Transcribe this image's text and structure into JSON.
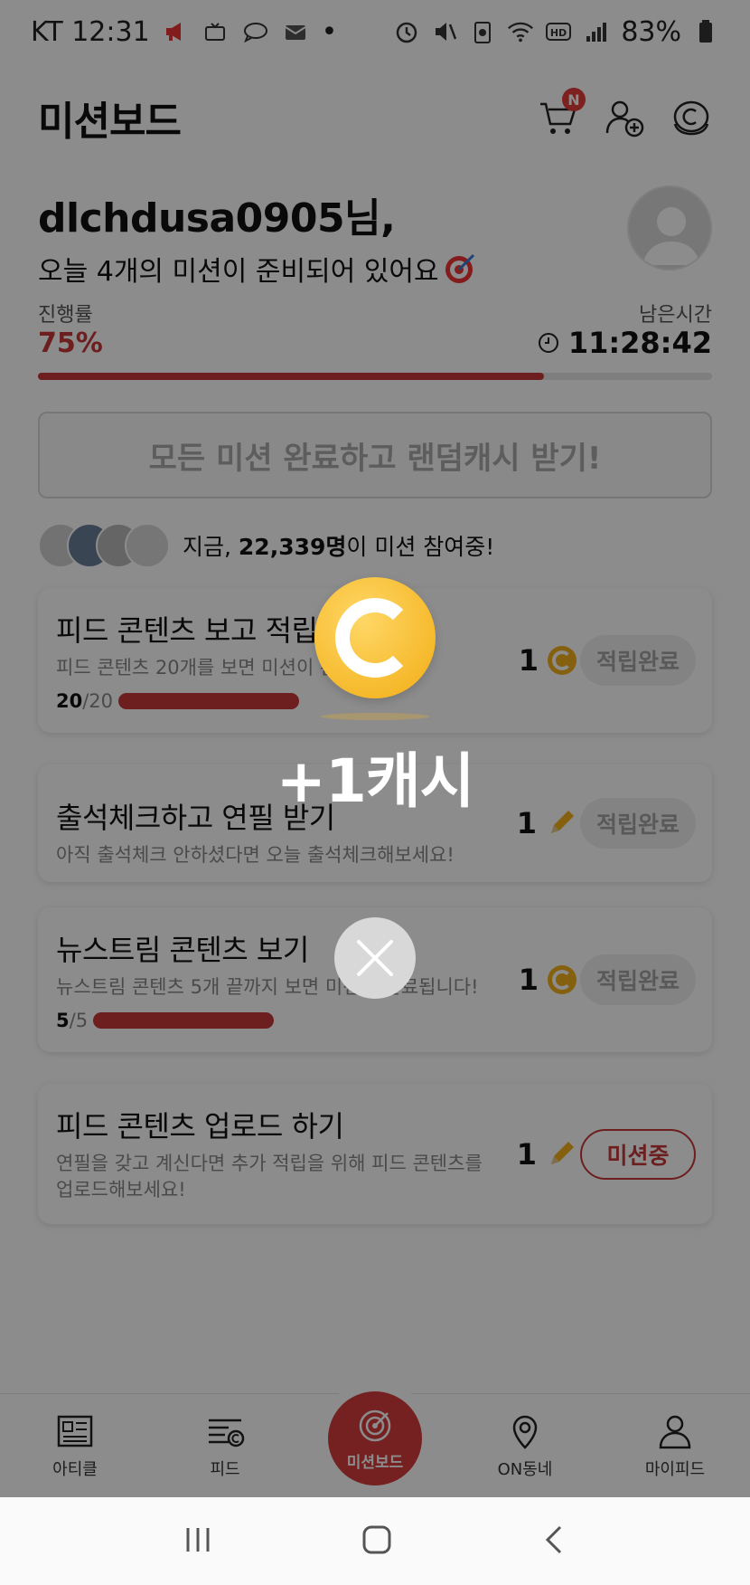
{
  "statusbar": {
    "carrier_time": "KT 12:31",
    "battery": "83%"
  },
  "header": {
    "title": "미션보드",
    "cart_badge": "N"
  },
  "greeting": {
    "username": "dlchdusa0905님,",
    "subtitle": "오늘 4개의 미션이 준비되어 있어요"
  },
  "progress": {
    "label": "진행률",
    "value": "75%",
    "fraction": 0.75,
    "remaining_label": "남은시간",
    "remaining_time": "11:28:42"
  },
  "all_complete_button": "모든 미션 완료하고 랜덤캐시 받기!",
  "participants": {
    "prefix": "지금, ",
    "count": "22,339명",
    "suffix": "이 미션 참여중!"
  },
  "missions": [
    {
      "title": "피드 콘텐츠 보고 적립",
      "desc": "피드 콘텐츠 20개를 보면 미션이 완",
      "progress_current": "20",
      "progress_total": "/20",
      "reward": "1",
      "reward_type": "coin",
      "state": "적립완료"
    },
    {
      "title": "출석체크하고 연필 받기",
      "desc": "아직 출석체크 안하셨다면 오늘 출석체크해보세요!",
      "reward": "1",
      "reward_type": "pencil",
      "state": "적립완료"
    },
    {
      "title": "뉴스트림 콘텐츠 보기",
      "desc": "뉴스트림 콘텐츠 5개 끝까지 보면 미션이 완료됩니다!",
      "progress_current": "5",
      "progress_total": "/5",
      "reward": "1",
      "reward_type": "coin",
      "state": "적립완료"
    },
    {
      "title": "피드 콘텐츠 업로드 하기",
      "desc": "연필을 갖고 계신다면 추가 적립을 위해 피드 콘텐츠를 업로드해보세요!",
      "reward": "1",
      "reward_type": "pencil",
      "state": "미션중"
    }
  ],
  "bottom_nav": [
    {
      "label": "아티클",
      "icon": "article-icon"
    },
    {
      "label": "피드",
      "icon": "feed-icon"
    },
    {
      "label": "미션보드",
      "icon": "target-icon"
    },
    {
      "label": "ON동네",
      "icon": "location-pin-icon"
    },
    {
      "label": "마이피드",
      "icon": "person-icon"
    }
  ],
  "popup": {
    "reward_text": "+1캐시"
  },
  "colors": {
    "accent": "#c73a3a",
    "coin": "#f2ad14"
  }
}
